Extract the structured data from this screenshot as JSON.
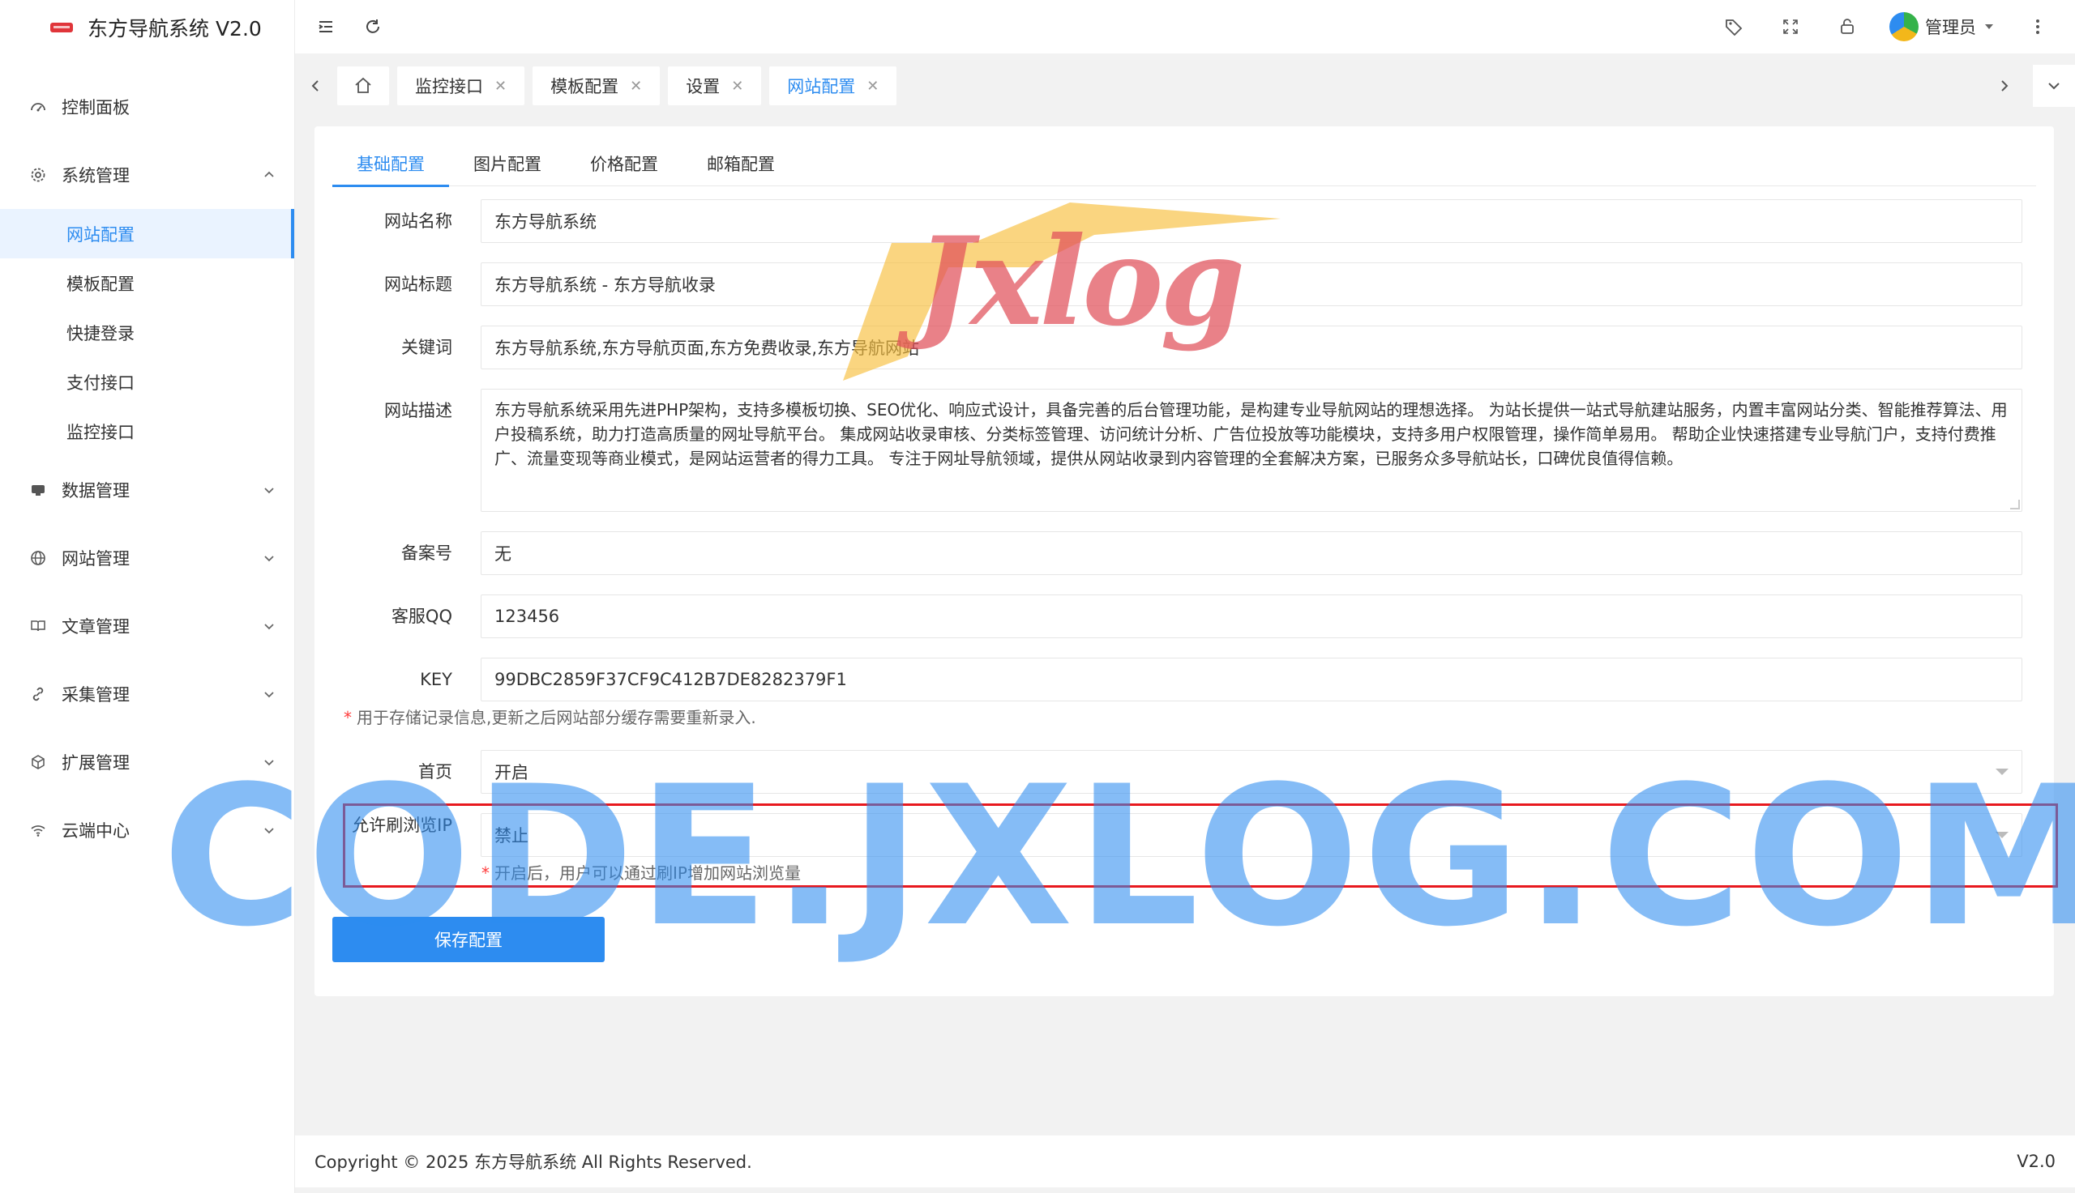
{
  "app": {
    "title": "东方导航系统 V2.0"
  },
  "sidebar": {
    "items": [
      {
        "label": "控制面板",
        "icon": "dashboard-icon"
      },
      {
        "label": "系统管理",
        "icon": "gear-icon",
        "expanded": true,
        "children": [
          "网站配置",
          "模板配置",
          "快捷登录",
          "支付接口",
          "监控接口"
        ]
      },
      {
        "label": "数据管理",
        "icon": "database-icon"
      },
      {
        "label": "网站管理",
        "icon": "globe-icon"
      },
      {
        "label": "文章管理",
        "icon": "book-icon"
      },
      {
        "label": "采集管理",
        "icon": "link-icon"
      },
      {
        "label": "扩展管理",
        "icon": "cube-icon"
      },
      {
        "label": "云端中心",
        "icon": "wifi-icon"
      }
    ],
    "active_child": "网站配置"
  },
  "header": {
    "user": "管理员"
  },
  "tabs": [
    {
      "label": "监控接口"
    },
    {
      "label": "模板配置"
    },
    {
      "label": "设置"
    },
    {
      "label": "网站配置",
      "active": true
    }
  ],
  "form_tabs": [
    "基础配置",
    "图片配置",
    "价格配置",
    "邮箱配置"
  ],
  "form": {
    "site_name": {
      "label": "网站名称",
      "value": "东方导航系统"
    },
    "site_title": {
      "label": "网站标题",
      "value": "东方导航系统 - 东方导航收录"
    },
    "keywords": {
      "label": "关键词",
      "value": "东方导航系统,东方导航页面,东方免费收录,东方导航网站"
    },
    "description": {
      "label": "网站描述",
      "value": "东方导航系统采用先进PHP架构，支持多模板切换、SEO优化、响应式设计，具备完善的后台管理功能，是构建专业导航网站的理想选择。 为站长提供一站式导航建站服务，内置丰富网站分类、智能推荐算法、用户投稿系统，助力打造高质量的网址导航平台。 集成网站收录审核、分类标签管理、访问统计分析、广告位投放等功能模块，支持多用户权限管理，操作简单易用。 帮助企业快速搭建专业导航门户，支持付费推广、流量变现等商业模式，是网站运营者的得力工具。 专注于网址导航领域，提供从网站收录到内容管理的全套解决方案，已服务众多导航站长，口碑优良值得信赖。"
    },
    "icp": {
      "label": "备案号",
      "value": "无"
    },
    "qq": {
      "label": "客服QQ",
      "value": "123456"
    },
    "key": {
      "label": "KEY",
      "value": "99DBC2859F37CF9C412B7DE8282379F1",
      "help_star": "*",
      "help": "用于存储记录信息,更新之后网站部分缓存需要重新录入."
    },
    "homepage": {
      "label": "首页",
      "value": "开启"
    },
    "allow_ip": {
      "label": "允许刷浏览IP",
      "value": "禁止",
      "help_star": "*",
      "help": "开启后，用户可以通过刷IP增加网站浏览量"
    },
    "save_label": "保存配置"
  },
  "footer": {
    "copyright": "Copyright © 2025 东方导航系统 All Rights Reserved.",
    "version": "V2.0"
  },
  "watermarks": {
    "logo_text": "Jxlog",
    "site_text": "CODE.JXLOG.COM"
  },
  "colors": {
    "accent": "#2d8cf0",
    "highlight_border": "#e8191e",
    "required_star": "#ff3b3b"
  }
}
